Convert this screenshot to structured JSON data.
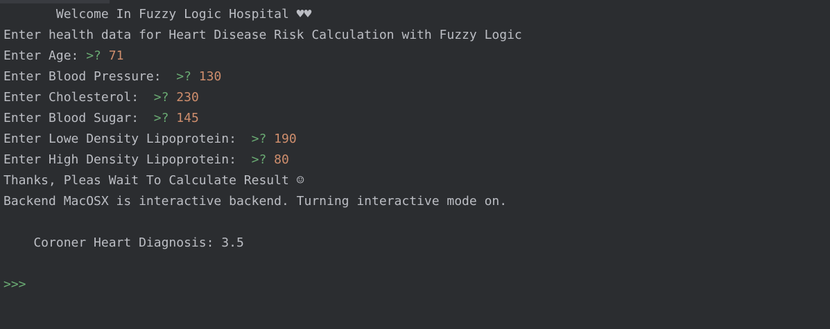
{
  "console": {
    "welcome": "       Welcome In Fuzzy Logic Hospital ♥♥",
    "intro": "Enter health data for Heart Disease Risk Calculation with Fuzzy Logic",
    "inputs": [
      {
        "label": "Enter Age: ",
        "prompt": ">? ",
        "value": "71"
      },
      {
        "label": "Enter Blood Pressure:  ",
        "prompt": ">? ",
        "value": "130"
      },
      {
        "label": "Enter Cholesterol:  ",
        "prompt": ">? ",
        "value": "230"
      },
      {
        "label": "Enter Blood Sugar:  ",
        "prompt": ">? ",
        "value": "145"
      },
      {
        "label": "Enter Lowe Density Lipoprotein:  ",
        "prompt": ">? ",
        "value": "190"
      },
      {
        "label": "Enter High Density Lipoprotein:  ",
        "prompt": ">? ",
        "value": "80"
      }
    ],
    "thanks": "Thanks, Pleas Wait To Calculate Result ☺",
    "backend": "Backend MacOSX is interactive backend. Turning interactive mode on.",
    "blank": "",
    "diagnosis": "    Coroner Heart Diagnosis: 3.5",
    "blank2": "",
    "caret": ">>>"
  },
  "colors": {
    "background": "#2b2d30",
    "text": "#bcbec4",
    "prompt": "#6aab73",
    "input_value": "#cf8e6d"
  }
}
